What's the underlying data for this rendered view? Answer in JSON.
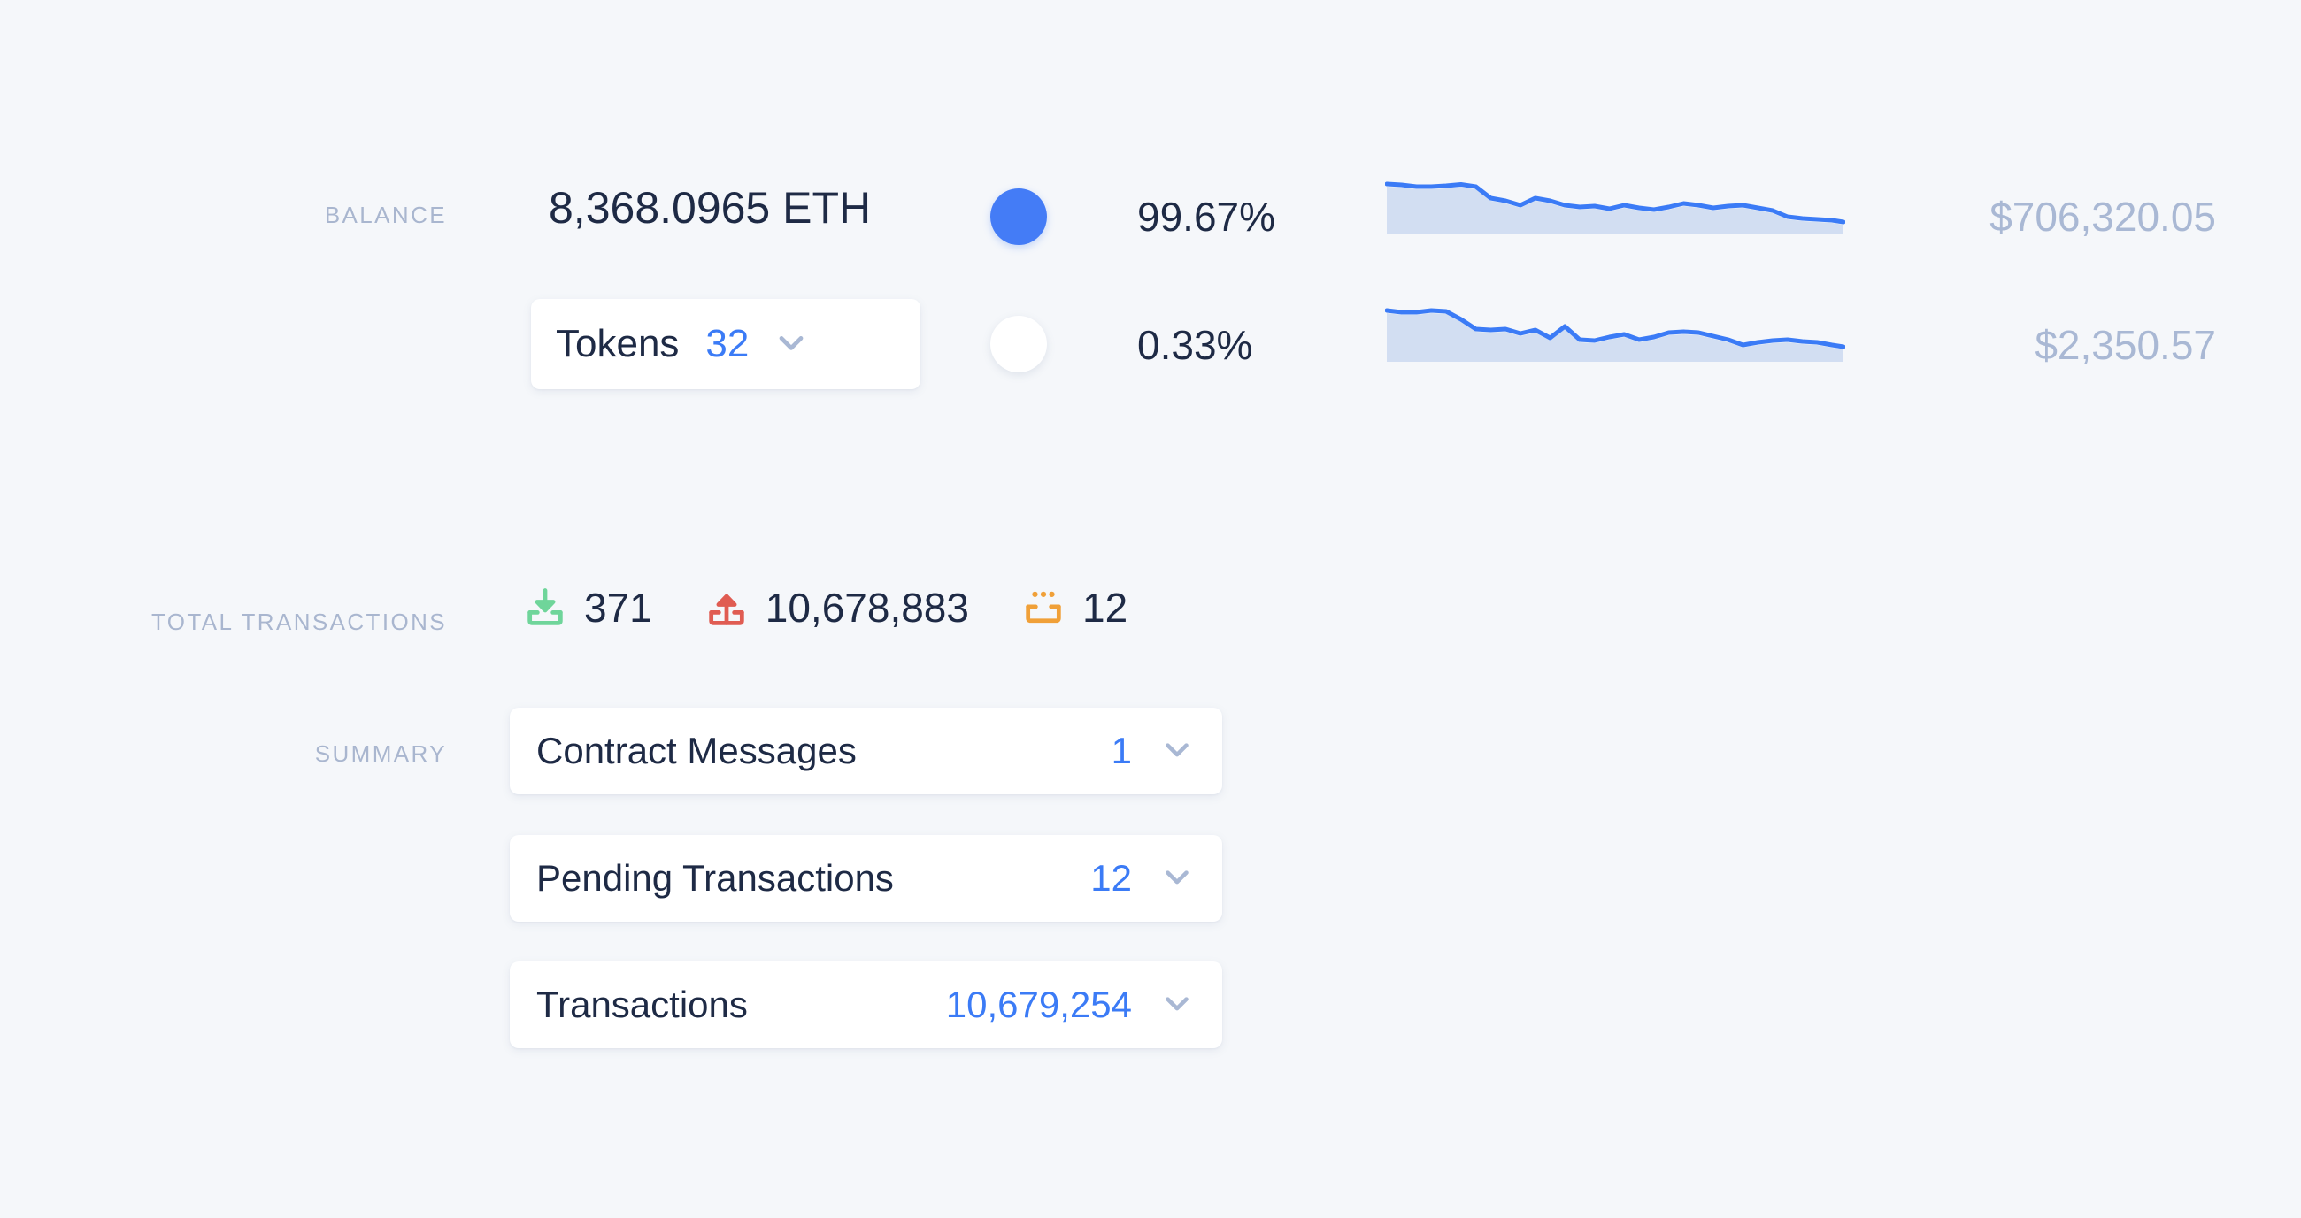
{
  "theme": {
    "background": "#f5f7fa",
    "card": "#ffffff",
    "text_dark": "#1e2a45",
    "text_muted": "#a9b6cf",
    "accent_blue": "#3b7bf6",
    "dot_blue": "#447cf6",
    "usd_grey": "#a9b8d4",
    "spark_line": "#3b7bf6",
    "spark_fill": "#d2def2",
    "icon_green": "#6fd59a",
    "icon_red": "#e05c52",
    "icon_orange": "#f0a038",
    "chevron": "#a9b8d4"
  },
  "balance": {
    "label": "BALANCE",
    "eth_amount": "8,368.0965 ETH",
    "tokens": {
      "label": "Tokens",
      "count": "32",
      "chevron_icon": "chevron-down-icon"
    },
    "rows": [
      {
        "dot": "filled",
        "percent": "99.67%",
        "usd": "$706,320.05"
      },
      {
        "dot": "empty",
        "percent": "0.33%",
        "usd": "$2,350.57"
      }
    ]
  },
  "total_transactions": {
    "label": "TOTAL TRANSACTIONS",
    "items": [
      {
        "icon": "inbox-download-icon",
        "color": "#6fd59a",
        "value": "371"
      },
      {
        "icon": "outbox-upload-icon",
        "color": "#e05c52",
        "value": "10,678,883"
      },
      {
        "icon": "pending-tray-icon",
        "color": "#f0a038",
        "value": "12"
      }
    ]
  },
  "summary": {
    "label": "SUMMARY",
    "rows": [
      {
        "label": "Contract Messages",
        "value": "1",
        "chevron_icon": "chevron-down-icon"
      },
      {
        "label": "Pending Transactions",
        "value": "12",
        "chevron_icon": "chevron-down-icon"
      },
      {
        "label": "Transactions",
        "value": "10,679,254",
        "chevron_icon": "chevron-down-icon"
      }
    ]
  },
  "chart_data": [
    {
      "type": "area",
      "name": "eth-balance-sparkline",
      "title": "",
      "xlabel": "",
      "ylabel": "",
      "grid": false,
      "legend": "none",
      "line_color": "#3b7bf6",
      "fill_color": "#d2def2",
      "x": [
        0,
        1,
        2,
        3,
        4,
        5,
        6,
        7,
        8,
        9,
        10,
        11,
        12,
        13,
        14,
        15,
        16,
        17,
        18,
        19,
        20,
        21,
        22,
        23,
        24,
        25,
        26,
        27,
        28,
        29,
        30,
        31
      ],
      "values": [
        74,
        73,
        71,
        71,
        72,
        73,
        71,
        58,
        55,
        50,
        58,
        55,
        50,
        48,
        49,
        46,
        50,
        47,
        45,
        48,
        52,
        50,
        47,
        49,
        50,
        47,
        44,
        37,
        35,
        34,
        33,
        31
      ],
      "ylim": [
        0,
        100
      ]
    },
    {
      "type": "area",
      "name": "tokens-balance-sparkline",
      "title": "",
      "xlabel": "",
      "ylabel": "",
      "grid": false,
      "legend": "none",
      "line_color": "#3b7bf6",
      "fill_color": "#d2def2",
      "x": [
        0,
        1,
        2,
        3,
        4,
        5,
        6,
        7,
        8,
        9,
        10,
        11,
        12,
        13,
        14,
        15,
        16,
        17,
        18,
        19,
        20,
        21,
        22,
        23,
        24,
        25,
        26,
        27,
        28,
        29,
        30,
        31
      ],
      "values": [
        76,
        74,
        74,
        76,
        75,
        66,
        55,
        54,
        55,
        50,
        54,
        46,
        58,
        44,
        43,
        47,
        50,
        44,
        47,
        52,
        53,
        52,
        48,
        44,
        38,
        41,
        43,
        44,
        42,
        41,
        38,
        36
      ],
      "ylim": [
        0,
        100
      ]
    }
  ]
}
